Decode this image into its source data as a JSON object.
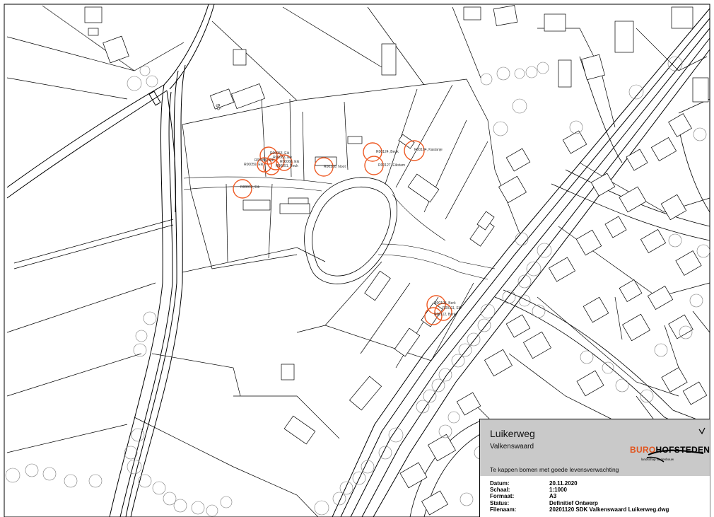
{
  "drawing": {
    "title": "Luikerweg",
    "subtitle": "Valkenswaard",
    "description": "Te kappen bomen met goede levensverwachting"
  },
  "logo": {
    "brand_part1": "BURO",
    "brand_part2": "HOFSTEDEN",
    "tagline": "landschap    stedenbouw"
  },
  "fields": [
    {
      "label": "Datum:",
      "value": "20.11.2020"
    },
    {
      "label": "Schaal:",
      "value": "1:1000"
    },
    {
      "label": "Formaat:",
      "value": "A3"
    },
    {
      "label": "Status:",
      "value": "Definitief Ontwerp"
    },
    {
      "label": "Filenaam:",
      "value": "20201120 SDK Valkenswaard Luikerweg.dwg"
    }
  ],
  "trees_to_cut": [
    "R00053, Eik",
    "R00063, Eik",
    "R00069, Eik",
    "R00051, Beuk",
    "R00059, Eik",
    "R00050, Eik",
    "R00100, Noot",
    "R00124, Beuk",
    "R00104, Kastanje",
    "R00127, Eikstam",
    "R00056, Eik",
    "R00108, Berk",
    "R00111, Eik",
    "R00112, Berk"
  ],
  "house_number": "85",
  "colors": {
    "cut_tree": "#ee5a24",
    "line": "#000000",
    "tree_outline": "#666666",
    "titleblock_bg": "#c9c9c9",
    "brand_orange": "#e2541d"
  }
}
